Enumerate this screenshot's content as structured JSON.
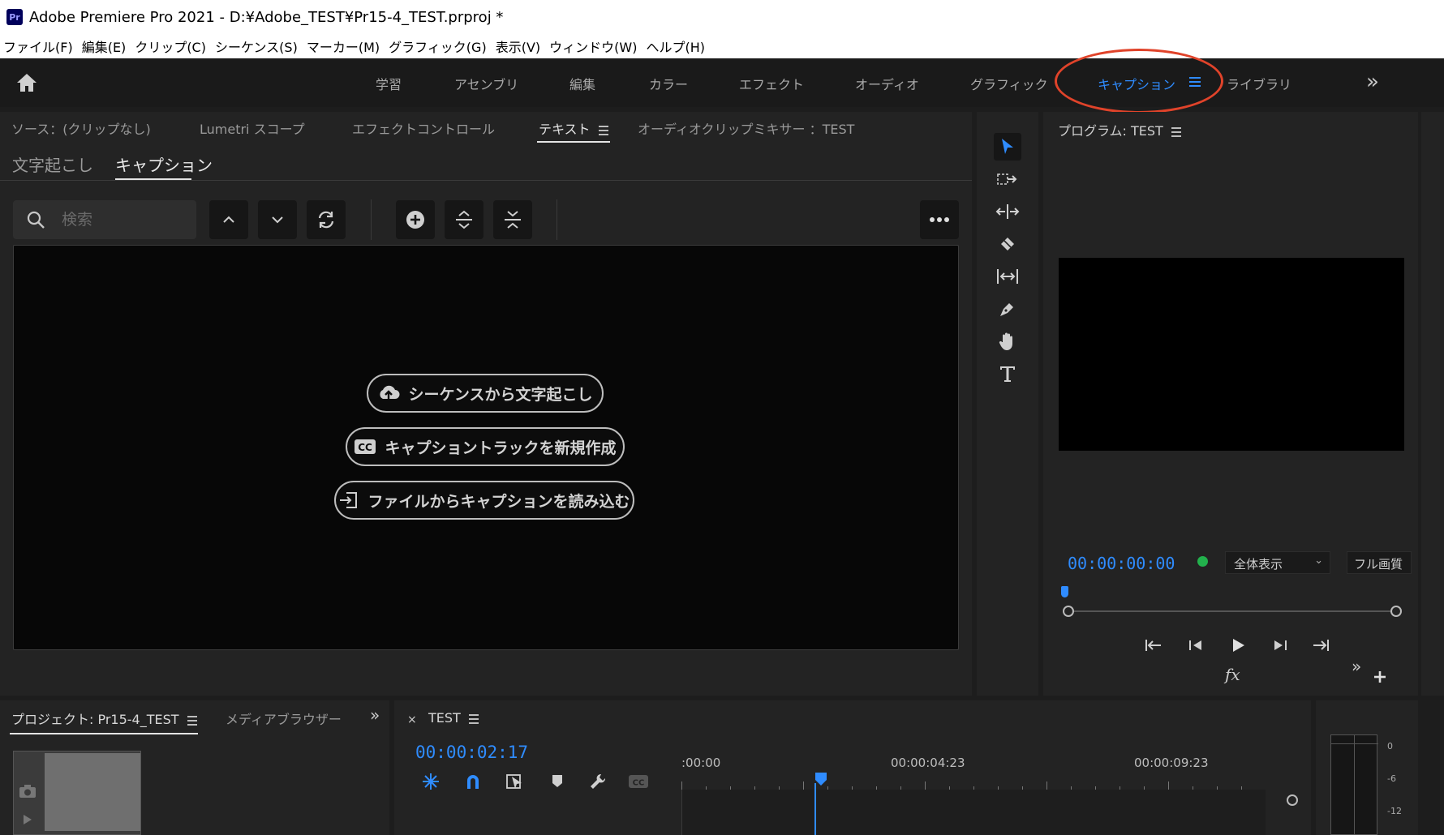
{
  "window": {
    "app_icon": "Pr",
    "title": "Adobe Premiere Pro 2021 - D:¥Adobe_TEST¥Pr15-4_TEST.prproj *"
  },
  "menu": [
    "ファイル(F)",
    "編集(E)",
    "クリップ(C)",
    "シーケンス(S)",
    "マーカー(M)",
    "グラフィック(G)",
    "表示(V)",
    "ウィンドウ(W)",
    "ヘルプ(H)"
  ],
  "workspaces": {
    "tabs": [
      "学習",
      "アセンブリ",
      "編集",
      "カラー",
      "エフェクト",
      "オーディオ",
      "グラフィック",
      "キャプション",
      "ライブラリ"
    ],
    "active": "キャプション",
    "active_color": "#2f8cff",
    "highlight_color": "#e0432a",
    "more": "»"
  },
  "source_panel": {
    "tabs": [
      "ソース：(クリップなし)",
      "Lumetri スコープ",
      "エフェクトコントロール",
      "テキスト",
      "オーディオクリップミキサー ：TEST"
    ],
    "active_tab": "テキスト"
  },
  "text_panel": {
    "subtabs": [
      "文字起こし",
      "キャプション"
    ],
    "active_subtab": "キャプション",
    "search_placeholder": "検索",
    "actions": [
      {
        "label": "シーケンスから文字起こし",
        "icon": "cloud-upload-icon"
      },
      {
        "label": "キャプショントラックを新規作成",
        "icon": "cc-icon"
      },
      {
        "label": "ファイルからキャプションを読み込む",
        "icon": "import-file-icon"
      }
    ]
  },
  "program_monitor": {
    "title": "プログラム: TEST",
    "timecode": "00:00:00:00",
    "fit": "全体表示",
    "quality": "フル画質",
    "fx": "fx"
  },
  "project_panel": {
    "tabs": [
      "プロジェクト: Pr15-4_TEST",
      "メディアブラウザー"
    ],
    "more": "»"
  },
  "timeline": {
    "close": "×",
    "sequence": "TEST",
    "timecode": "00:00:02:17",
    "ruler_labels": [
      ":00:00",
      "00:00:04:23",
      "00:00:09:23"
    ]
  },
  "audio_meter": {
    "labels": [
      "0",
      "-6",
      "-12"
    ]
  }
}
